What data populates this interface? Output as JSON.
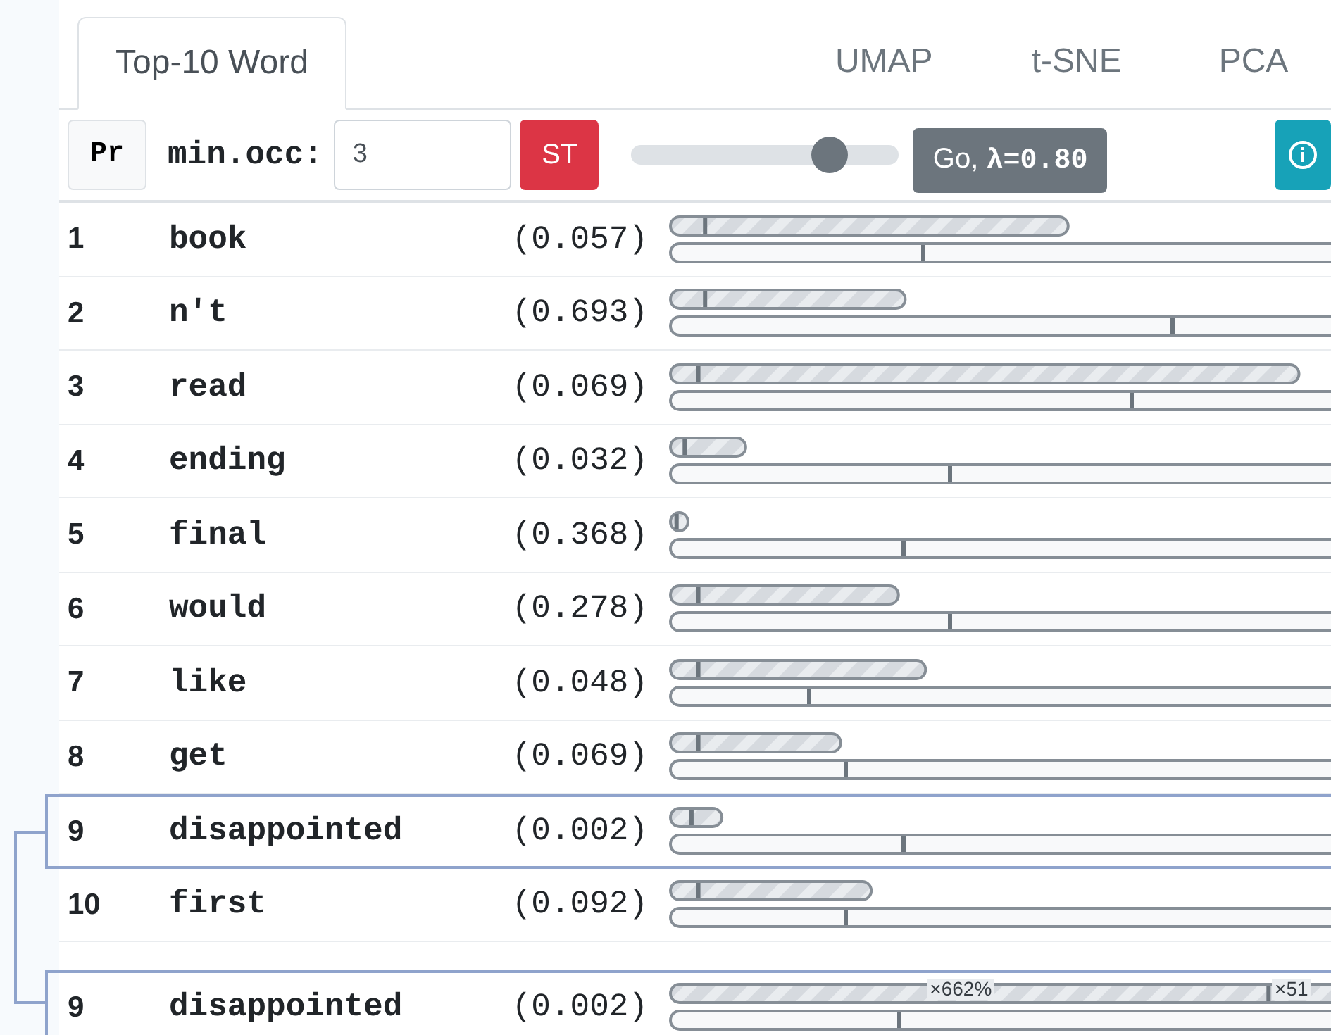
{
  "tabs": [
    {
      "label": "Top-10 Word",
      "selected": true
    },
    {
      "label": "UMAP",
      "selected": false
    },
    {
      "label": "t-SNE",
      "selected": false
    },
    {
      "label": "PCA",
      "selected": false
    }
  ],
  "toolbar": {
    "pr_button": "Pr",
    "min_occ_label": "min.occ:",
    "min_occ_value": "3",
    "st_button": "ST",
    "slider": {
      "level": 0.78
    },
    "go_button": "Go, **λ=0.80**"
  },
  "rows": [
    {
      "rank": "1",
      "word": "book",
      "score": "(0.057)",
      "highlighted": false,
      "upper_bar": {
        "level": 0.59,
        "tick": {
          "level": 0.05
        }
      },
      "lower_bar": {
        "level": 0.37
      }
    },
    {
      "rank": "2",
      "word": "n't",
      "score": "(0.693)",
      "highlighted": false,
      "upper_bar": {
        "level": 0.35,
        "tick": {
          "level": 0.05
        }
      },
      "lower_bar": {
        "level": 0.74
      }
    },
    {
      "rank": "3",
      "word": "read",
      "score": "(0.069)",
      "highlighted": false,
      "upper_bar": {
        "level": 0.93,
        "tick": {
          "level": 0.04
        }
      },
      "lower_bar": {
        "level": 0.68
      }
    },
    {
      "rank": "4",
      "word": "ending",
      "score": "(0.032)",
      "highlighted": false,
      "upper_bar": {
        "level": 0.115,
        "tick": {
          "level": 0.02
        }
      },
      "lower_bar": {
        "level": 0.41
      }
    },
    {
      "rank": "5",
      "word": "final",
      "score": "(0.368)",
      "highlighted": false,
      "upper_bar": {
        "level": 0.03,
        "tick": {
          "level": 0.008
        }
      },
      "lower_bar": {
        "level": 0.34
      }
    },
    {
      "rank": "6",
      "word": "would",
      "score": "(0.278)",
      "highlighted": false,
      "upper_bar": {
        "level": 0.34,
        "tick": {
          "level": 0.04
        }
      },
      "lower_bar": {
        "level": 0.41
      }
    },
    {
      "rank": "7",
      "word": "like",
      "score": "(0.048)",
      "highlighted": false,
      "upper_bar": {
        "level": 0.38,
        "tick": {
          "level": 0.04
        }
      },
      "lower_bar": {
        "level": 0.2
      }
    },
    {
      "rank": "8",
      "word": "get",
      "score": "(0.069)",
      "highlighted": false,
      "upper_bar": {
        "level": 0.255,
        "tick": {
          "level": 0.04
        }
      },
      "lower_bar": {
        "level": 0.255
      }
    },
    {
      "rank": "9",
      "word": "disappointed",
      "score": "(0.002)",
      "highlighted": true,
      "upper_bar": {
        "level": 0.08,
        "tick": {
          "level": 0.03
        }
      },
      "lower_bar": {
        "level": 0.34
      }
    },
    {
      "rank": "10",
      "word": "first",
      "score": "(0.092)",
      "highlighted": false,
      "upper_bar": {
        "level": 0.3,
        "tick": {
          "level": 0.04
        }
      },
      "lower_bar": {
        "level": 0.255
      }
    }
  ],
  "pinned_row": {
    "rank": "9",
    "word": "disappointed",
    "score": "(0.002)",
    "highlighted": true,
    "upper_bar": {
      "level": 1,
      "tick": {
        "level": 0.88
      }
    },
    "lower_bar": {
      "level": 0.335
    },
    "bar_labels": [
      "×662%",
      "×51"
    ]
  }
}
